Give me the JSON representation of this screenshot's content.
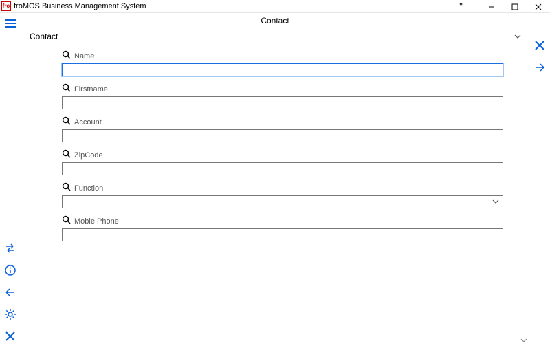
{
  "window": {
    "logo_text": "fro",
    "title": "froMOS Business Management System",
    "quotes": "\"\""
  },
  "header": {
    "title": "Contact"
  },
  "selector": {
    "value": "Contact"
  },
  "fields": [
    {
      "key": "name",
      "label": "Name",
      "type": "text",
      "focused": true
    },
    {
      "key": "firstname",
      "label": "Firstname",
      "type": "text",
      "focused": false
    },
    {
      "key": "account",
      "label": "Account",
      "type": "text",
      "focused": false
    },
    {
      "key": "zipcode",
      "label": "ZipCode",
      "type": "text",
      "focused": false
    },
    {
      "key": "function",
      "label": "Function",
      "type": "select",
      "focused": false
    },
    {
      "key": "mobile",
      "label": "Moble Phone",
      "type": "text",
      "focused": false
    }
  ],
  "left_sidebar": {
    "top_icon": "hamburger-icon",
    "bottom_icons": [
      "swap-icon",
      "info-icon",
      "back-icon",
      "gear-icon",
      "close-icon"
    ]
  },
  "right_sidebar": {
    "icons": [
      "close-icon",
      "forward-icon"
    ]
  }
}
